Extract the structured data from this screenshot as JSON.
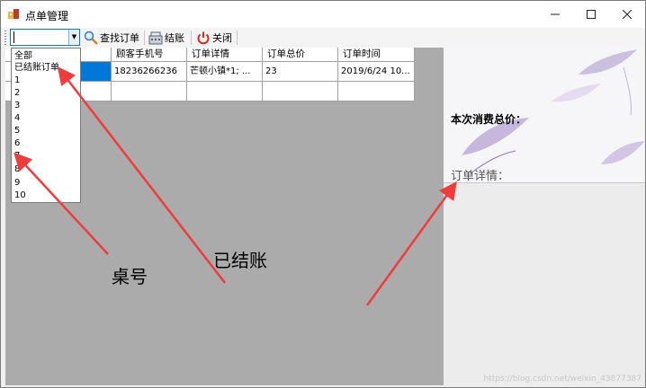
{
  "window": {
    "title": "点单管理"
  },
  "toolbar": {
    "combo_value": "",
    "search_label": "查找订单",
    "checkout_label": "结账",
    "close_label": "关闭"
  },
  "grid": {
    "headers": [
      "",
      "顾客手机号",
      "订单详情",
      "订单总价",
      "订单时间"
    ],
    "row": [
      "",
      "18236266236",
      "芒顿小镇*1; ...",
      "23",
      "2019/6/24 10..."
    ]
  },
  "dropdown": {
    "items": [
      "全部",
      "已结账订单",
      "1",
      "2",
      "3",
      "4",
      "5",
      "6",
      "7",
      "8",
      "9",
      "10"
    ]
  },
  "right_panel": {
    "total_label": "本次消费总价：",
    "detail_label": "订单详情：",
    "watermark": "https://blog.csdn.net/weixin_43877387"
  },
  "annotations": {
    "table_number": "桌号",
    "checked_out": "已结账"
  },
  "colors": {
    "selection": "#0078d7",
    "arrow": "#f03c3c",
    "client_bg": "#ababab"
  }
}
